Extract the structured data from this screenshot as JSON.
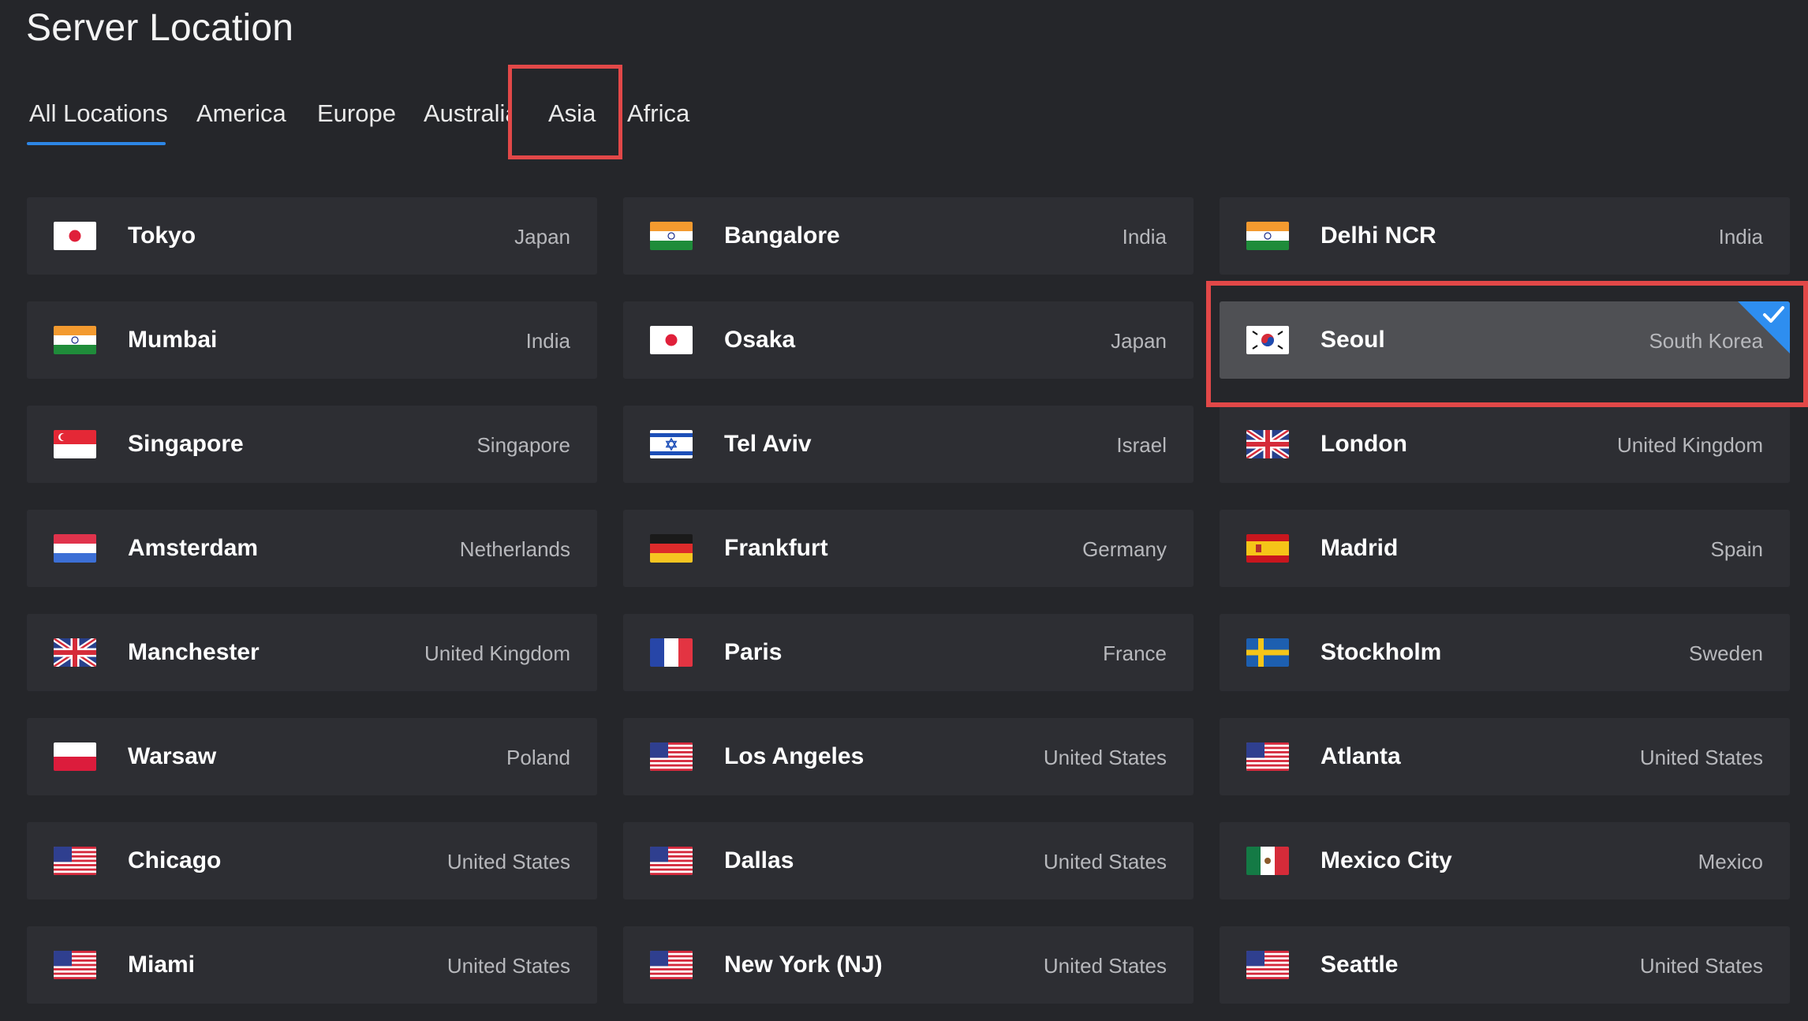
{
  "page": {
    "title": "Server Location"
  },
  "tabs": [
    {
      "label": "All Locations",
      "active": true
    },
    {
      "label": "America"
    },
    {
      "label": "Europe"
    },
    {
      "label": "Australia"
    },
    {
      "label": "Asia",
      "highlighted": true
    },
    {
      "label": "Africa"
    }
  ],
  "accent_color": "#2d86e6",
  "highlight_color": "#e24848",
  "locations": [
    {
      "city": "Tokyo",
      "country": "Japan",
      "flag": "japan-flag-icon"
    },
    {
      "city": "Bangalore",
      "country": "India",
      "flag": "india-flag-icon"
    },
    {
      "city": "Delhi NCR",
      "country": "India",
      "flag": "india-flag-icon"
    },
    {
      "city": "Mumbai",
      "country": "India",
      "flag": "india-flag-icon"
    },
    {
      "city": "Osaka",
      "country": "Japan",
      "flag": "japan-flag-icon"
    },
    {
      "city": "Seoul",
      "country": "South Korea",
      "flag": "south-korea-flag-icon",
      "selected": true
    },
    {
      "city": "Singapore",
      "country": "Singapore",
      "flag": "singapore-flag-icon"
    },
    {
      "city": "Tel Aviv",
      "country": "Israel",
      "flag": "israel-flag-icon"
    },
    {
      "city": "London",
      "country": "United Kingdom",
      "flag": "uk-flag-icon"
    },
    {
      "city": "Amsterdam",
      "country": "Netherlands",
      "flag": "netherlands-flag-icon"
    },
    {
      "city": "Frankfurt",
      "country": "Germany",
      "flag": "germany-flag-icon"
    },
    {
      "city": "Madrid",
      "country": "Spain",
      "flag": "spain-flag-icon"
    },
    {
      "city": "Manchester",
      "country": "United Kingdom",
      "flag": "uk-flag-icon"
    },
    {
      "city": "Paris",
      "country": "France",
      "flag": "france-flag-icon"
    },
    {
      "city": "Stockholm",
      "country": "Sweden",
      "flag": "sweden-flag-icon"
    },
    {
      "city": "Warsaw",
      "country": "Poland",
      "flag": "poland-flag-icon"
    },
    {
      "city": "Los Angeles",
      "country": "United States",
      "flag": "usa-flag-icon"
    },
    {
      "city": "Atlanta",
      "country": "United States",
      "flag": "usa-flag-icon"
    },
    {
      "city": "Chicago",
      "country": "United States",
      "flag": "usa-flag-icon"
    },
    {
      "city": "Dallas",
      "country": "United States",
      "flag": "usa-flag-icon"
    },
    {
      "city": "Mexico City",
      "country": "Mexico",
      "flag": "mexico-flag-icon"
    },
    {
      "city": "Miami",
      "country": "United States",
      "flag": "usa-flag-icon"
    },
    {
      "city": "New York (NJ)",
      "country": "United States",
      "flag": "usa-flag-icon"
    },
    {
      "city": "Seattle",
      "country": "United States",
      "flag": "usa-flag-icon"
    }
  ]
}
